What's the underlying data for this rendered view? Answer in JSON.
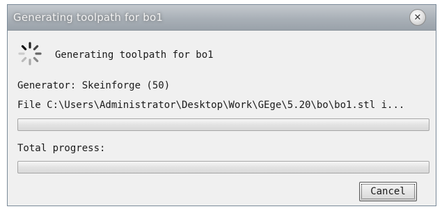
{
  "window": {
    "title": "Generating toolpath for bo1",
    "close_icon": "close-icon"
  },
  "status": {
    "spinner_icon": "spinner-icon",
    "message": "Generating toolpath for bo1"
  },
  "generator": {
    "text": "Generator: Skeinforge (50)"
  },
  "file": {
    "text": "File C:\\Users\\Administrator\\Desktop\\Work\\GEge\\5.20\\bo\\bo1.stl i...",
    "progress": 0
  },
  "total": {
    "label": "Total progress:",
    "progress": 0
  },
  "buttons": {
    "cancel": "Cancel"
  },
  "colors": {
    "titlebar": "#a9b0b7",
    "dialog_bg": "#f0f0f0",
    "progress_fill": "#3fbf3f"
  }
}
